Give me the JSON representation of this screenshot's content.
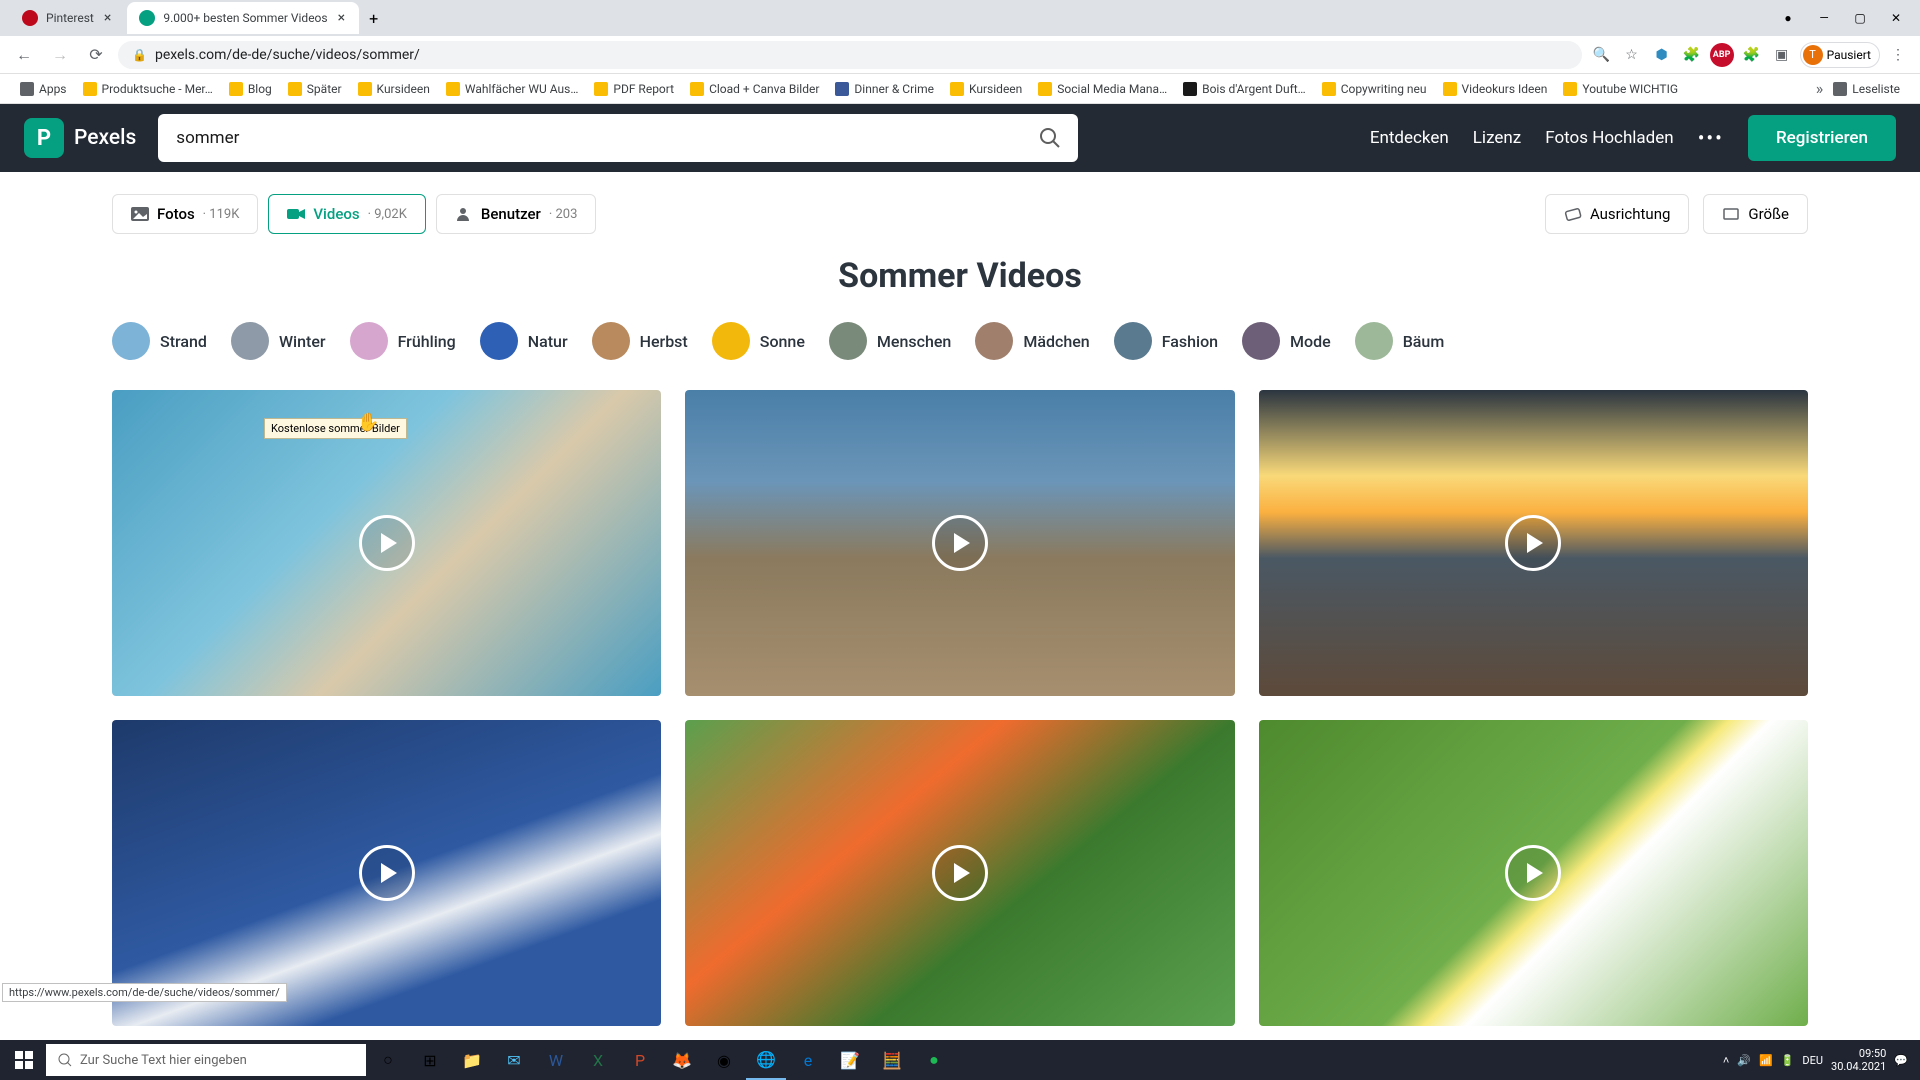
{
  "browser": {
    "tabs": [
      {
        "title": "Pinterest",
        "favicon": "#bd081c",
        "active": false
      },
      {
        "title": "9.000+ besten Sommer Videos",
        "favicon": "#05a081",
        "active": true
      }
    ],
    "url": "pexels.com/de-de/suche/videos/sommer/",
    "profile_label": "Pausiert",
    "profile_initial": "T",
    "status_bar": "https://www.pexels.com/de-de/suche/videos/sommer/",
    "bookmarks": [
      "Apps",
      "Produktsuche - Mer…",
      "Blog",
      "Später",
      "Kursideen",
      "Wahlfächer WU Aus…",
      "PDF Report",
      "Cload + Canva Bilder",
      "Dinner & Crime",
      "Kursideen",
      "Social Media Mana…",
      "Bois d'Argent Duft…",
      "Copywriting neu",
      "Videokurs Ideen",
      "Youtube WICHTIG"
    ],
    "reading_list": "Leseliste"
  },
  "header": {
    "brand": "Pexels",
    "search_value": "sommer",
    "nav": {
      "explore": "Entdecken",
      "license": "Lizenz",
      "upload": "Fotos Hochladen",
      "register": "Registrieren"
    }
  },
  "filters": {
    "photos": {
      "label": "Fotos",
      "count": "119K"
    },
    "videos": {
      "label": "Videos",
      "count": "9,02K"
    },
    "users": {
      "label": "Benutzer",
      "count": "203"
    },
    "tooltip": "Kostenlose sommer Bilder",
    "orientation": "Ausrichtung",
    "size": "Größe"
  },
  "page_heading": "Sommer Videos",
  "tags": [
    {
      "label": "Strand",
      "color": "#7eb3d8"
    },
    {
      "label": "Winter",
      "color": "#8e9aa7"
    },
    {
      "label": "Frühling",
      "color": "#d7a6cf"
    },
    {
      "label": "Natur",
      "color": "#2e60b5"
    },
    {
      "label": "Herbst",
      "color": "#b88a5e"
    },
    {
      "label": "Sonne",
      "color": "#f3b80c"
    },
    {
      "label": "Menschen",
      "color": "#7a8a7a"
    },
    {
      "label": "Mädchen",
      "color": "#a0806d"
    },
    {
      "label": "Fashion",
      "color": "#5a7a8f"
    },
    {
      "label": "Mode",
      "color": "#6d5f78"
    },
    {
      "label": "Bäum",
      "color": "#9cb898"
    }
  ],
  "videos": [
    {
      "bg": "linear-gradient(135deg,#4a9ec2 0%,#7fc4dd 40%,#d9c9aa 60%,#4a9ec2 100%)"
    },
    {
      "bg": "linear-gradient(180deg,#4a7fa8 0%,#6b95b8 30%,#8b7a5e 55%,#a68f6f 100%)"
    },
    {
      "bg": "linear-gradient(180deg,#2b3540 0%,#f9d979 28%,#fbb040 40%,#4a5864 55%,#5d4a3a 100%)"
    },
    {
      "bg": "linear-gradient(160deg,#1e3a6b 0%,#2f5aa2 50%,#e8ecf2 62%,#2f5aa2 75%)"
    },
    {
      "bg": "linear-gradient(140deg,#5aa04e 0%,#ef6b2e 35%,#3b7a2e 60%,#5aa04e 100%)"
    },
    {
      "bg": "linear-gradient(135deg,#4e8a2e 0%,#6fae4b 50%,#f6e97b 55%,#ffffff 60%,#6fae4b 100%)"
    }
  ],
  "taskbar": {
    "search_placeholder": "Zur Suche Text hier eingeben",
    "lang": "DEU",
    "time": "09:50",
    "date": "30.04.2021"
  }
}
